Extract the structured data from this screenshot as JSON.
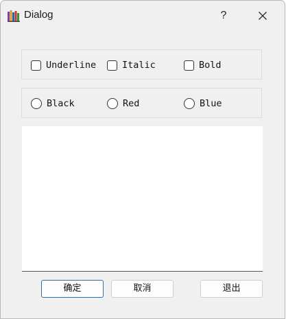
{
  "window": {
    "title": "Dialog",
    "help_label": "?"
  },
  "style_options": [
    {
      "label": "Underline",
      "checked": false
    },
    {
      "label": "Italic",
      "checked": false
    },
    {
      "label": "Bold",
      "checked": false
    }
  ],
  "color_options": [
    {
      "label": "Black",
      "selected": false
    },
    {
      "label": "Red",
      "selected": false
    },
    {
      "label": "Blue",
      "selected": false
    }
  ],
  "text_area": {
    "value": ""
  },
  "buttons": {
    "ok": "确定",
    "cancel": "取消",
    "exit": "退出"
  },
  "icons": {
    "app": "books-icon",
    "help": "help-icon",
    "close": "close-icon"
  },
  "colors": {
    "window_bg": "#f0f0f0",
    "default_button_border": "#2a6fb0"
  }
}
